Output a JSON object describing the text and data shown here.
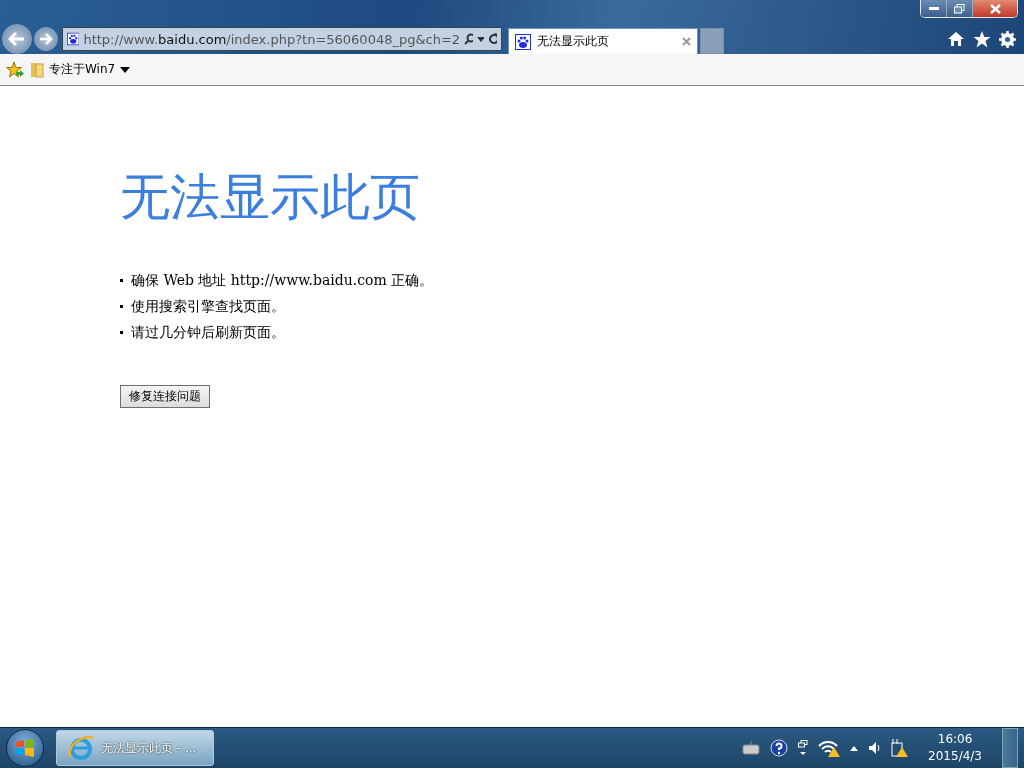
{
  "browser": {
    "address": "http://www.**baidu.com**/index.php?tn=56060048_pg&ch=2",
    "tabs": [
      {
        "label": "无法显示此页",
        "selected": true
      }
    ],
    "favorites": [
      {
        "label": "专注于Win7"
      }
    ]
  },
  "page": {
    "heading": "无法显示此页",
    "tips": [
      "确保 Web 地址 http://www.baidu.com 正确。",
      "使用搜索引擎查找页面。",
      "请过几分钟后刷新页面。"
    ],
    "button": "修复连接问题"
  },
  "taskbar": {
    "tasks": [
      {
        "label": "无法显示此页 - ...",
        "selected": true
      }
    ],
    "time": "16:06",
    "date": "2015/4/3"
  }
}
